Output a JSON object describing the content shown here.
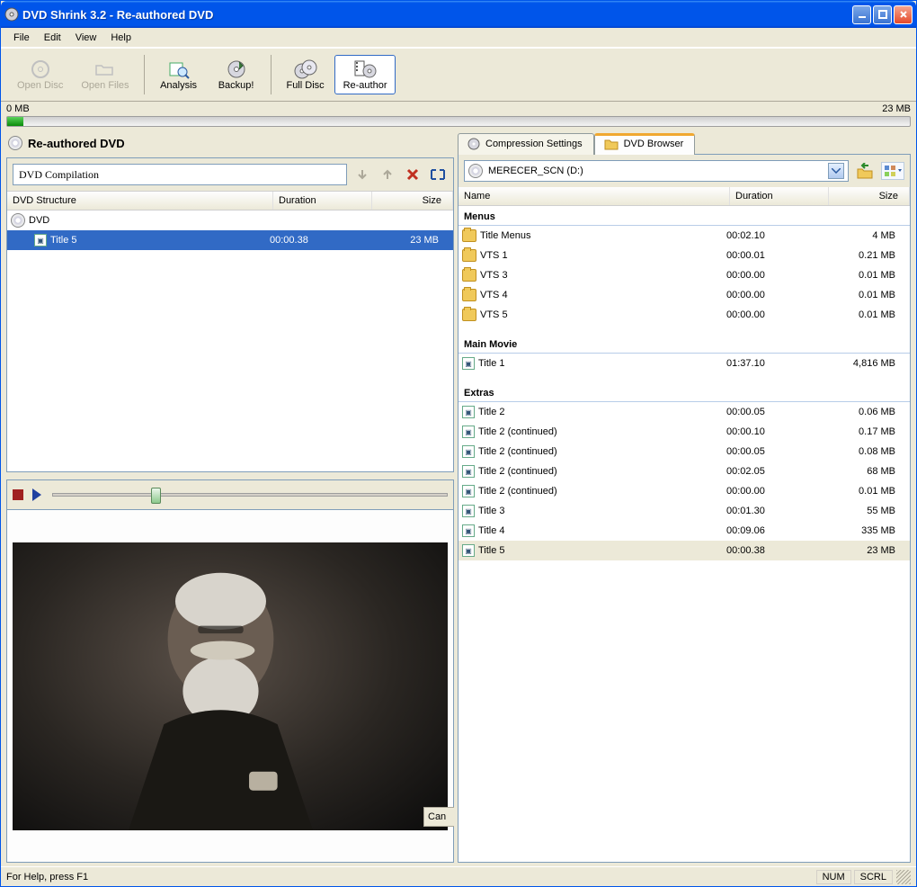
{
  "window": {
    "title": "DVD Shrink 3.2 - Re-authored DVD"
  },
  "menu": {
    "file": "File",
    "edit": "Edit",
    "view": "View",
    "help": "Help"
  },
  "toolbar": {
    "open_disc": "Open Disc",
    "open_files": "Open Files",
    "analysis": "Analysis",
    "backup": "Backup!",
    "full_disc": "Full Disc",
    "re_author": "Re-author"
  },
  "sizebar": {
    "left": "0 MB",
    "right": "23 MB"
  },
  "left_panel": {
    "title": "Re-authored DVD",
    "compile_name": "DVD Compilation",
    "headers": {
      "structure": "DVD Structure",
      "duration": "Duration",
      "size": "Size"
    },
    "root": "DVD",
    "item": {
      "name": "Title 5",
      "duration": "00:00.38",
      "size": "23 MB"
    }
  },
  "preview": {
    "cancel": "Can"
  },
  "right_panel": {
    "tabs": {
      "compression": "Compression Settings",
      "browser": "DVD Browser"
    },
    "drive": "MERECER_SCN (D:)",
    "headers": {
      "name": "Name",
      "duration": "Duration",
      "size": "Size"
    },
    "sections": {
      "menus": "Menus",
      "menus_items": [
        {
          "name": "Title Menus",
          "duration": "00:02.10",
          "size": "4 MB"
        },
        {
          "name": "VTS 1",
          "duration": "00:00.01",
          "size": "0.21 MB"
        },
        {
          "name": "VTS 3",
          "duration": "00:00.00",
          "size": "0.01 MB"
        },
        {
          "name": "VTS 4",
          "duration": "00:00.00",
          "size": "0.01 MB"
        },
        {
          "name": "VTS 5",
          "duration": "00:00.00",
          "size": "0.01 MB"
        }
      ],
      "main_movie": "Main Movie",
      "main_items": [
        {
          "name": "Title 1",
          "duration": "01:37.10",
          "size": "4,816 MB"
        }
      ],
      "extras": "Extras",
      "extras_items": [
        {
          "name": "Title 2",
          "duration": "00:00.05",
          "size": "0.06 MB"
        },
        {
          "name": "Title 2 (continued)",
          "duration": "00:00.10",
          "size": "0.17 MB"
        },
        {
          "name": "Title 2 (continued)",
          "duration": "00:00.05",
          "size": "0.08 MB"
        },
        {
          "name": "Title 2 (continued)",
          "duration": "00:02.05",
          "size": "68 MB"
        },
        {
          "name": "Title 2 (continued)",
          "duration": "00:00.00",
          "size": "0.01 MB"
        },
        {
          "name": "Title 3",
          "duration": "00:01.30",
          "size": "55 MB"
        },
        {
          "name": "Title 4",
          "duration": "00:09.06",
          "size": "335 MB"
        },
        {
          "name": "Title 5",
          "duration": "00:00.38",
          "size": "23 MB"
        }
      ]
    }
  },
  "status": {
    "help": "For Help, press F1",
    "num": "NUM",
    "scrl": "SCRL"
  }
}
